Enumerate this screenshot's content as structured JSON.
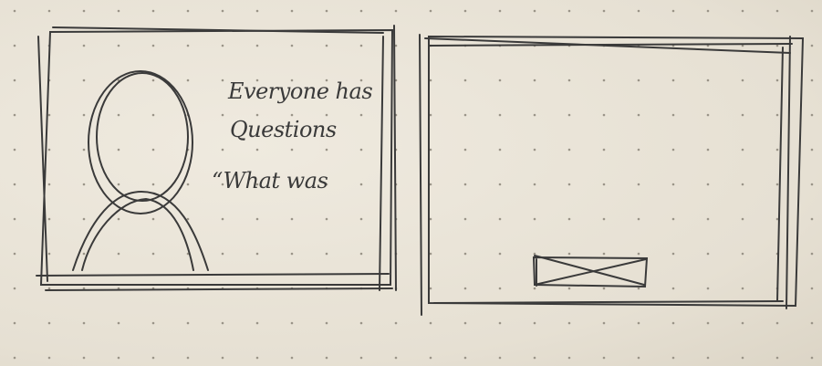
{
  "sketch": {
    "left_panel": {
      "headline_line1": "Everyone has",
      "headline_line2": "Questions",
      "quote_start": "“What was",
      "avatar_icon": "person-silhouette-icon"
    },
    "right_panel": {
      "button_placeholder_icon": "crossed-box-placeholder-icon"
    },
    "colors": {
      "paper": "#e9e4d8",
      "pencil": "#3a3a3a"
    }
  }
}
